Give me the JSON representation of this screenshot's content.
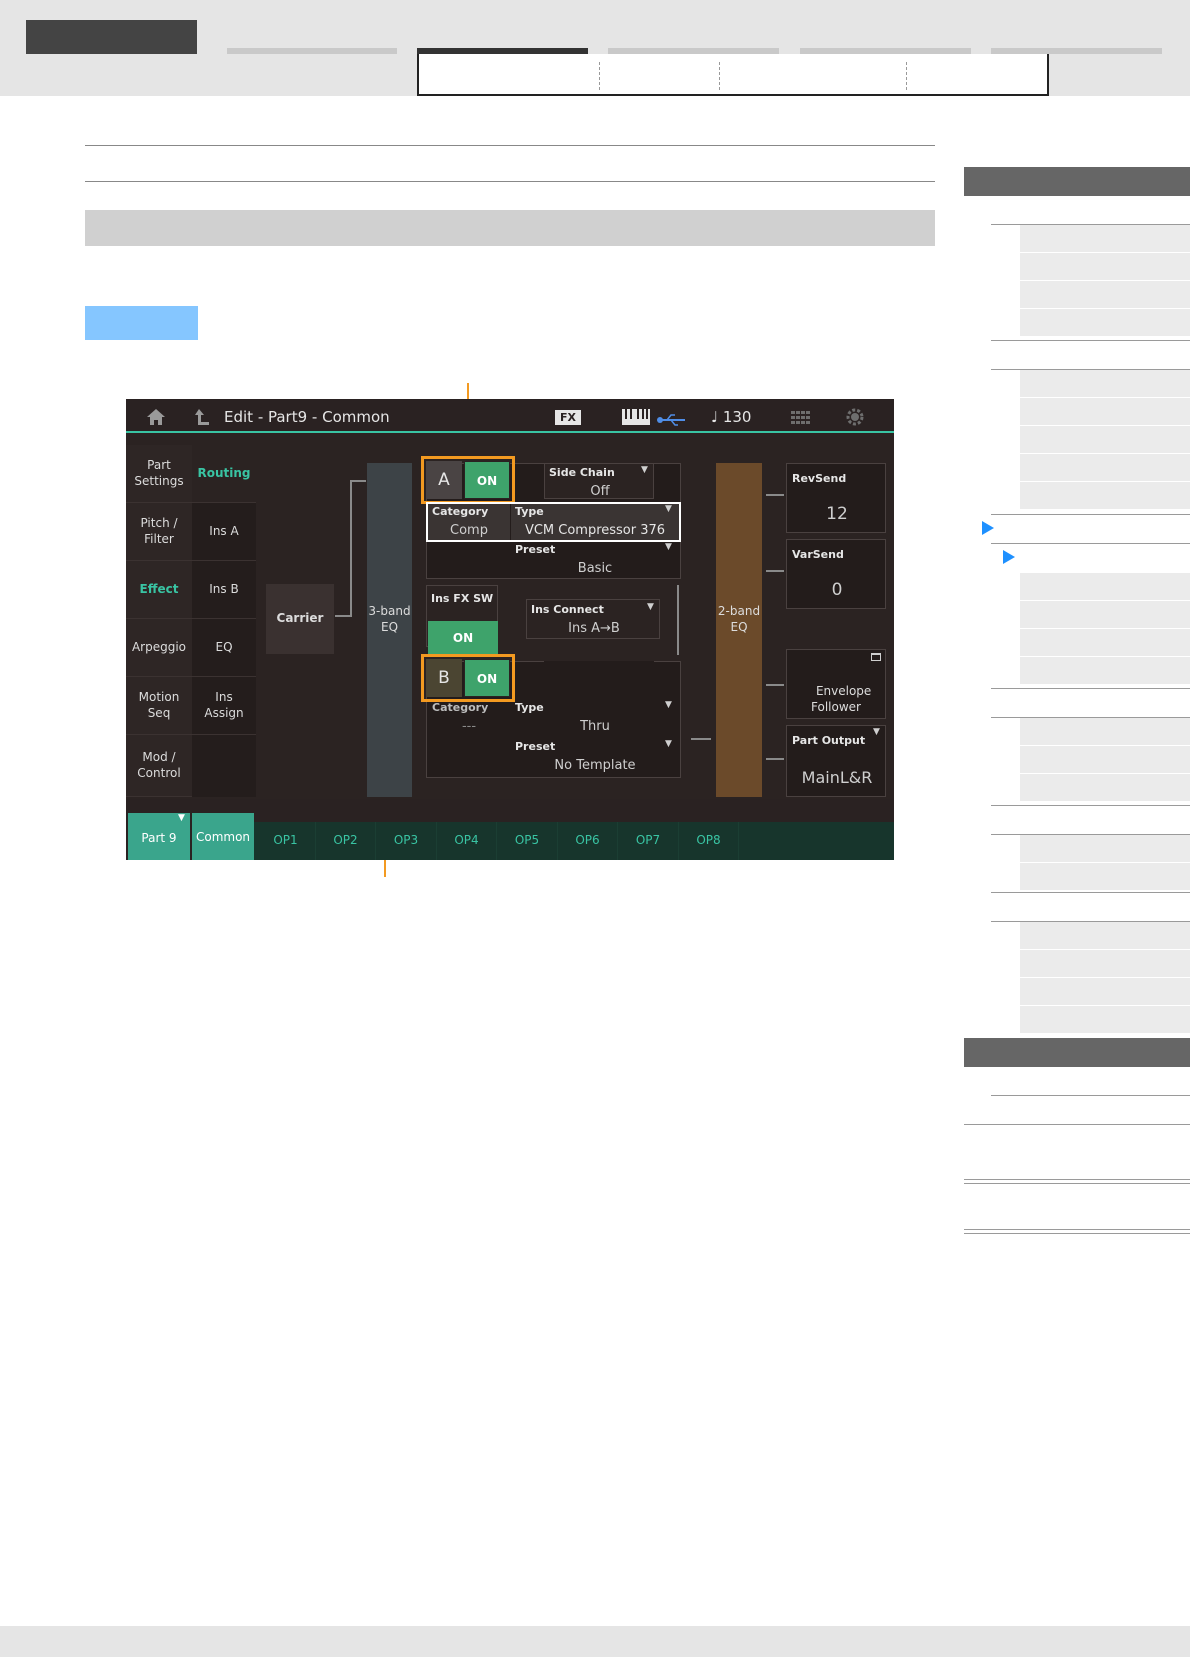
{
  "screen": {
    "title": "Edit - Part9 - Common",
    "fx_label": "FX",
    "tempo": "♩ 130",
    "left_tabs": [
      {
        "label": "Part\nSettings",
        "active": false
      },
      {
        "label": "Pitch /\nFilter",
        "active": false
      },
      {
        "label": "Effect",
        "active": true
      },
      {
        "label": "Arpeggio",
        "active": false
      },
      {
        "label": "Motion\nSeq",
        "active": false
      },
      {
        "label": "Mod /\nControl",
        "active": false
      }
    ],
    "sub_tabs": [
      {
        "label": "Routing",
        "active": true
      },
      {
        "label": "Ins A",
        "active": false
      },
      {
        "label": "Ins B",
        "active": false
      },
      {
        "label": "EQ",
        "active": false
      },
      {
        "label": "Ins\nAssign",
        "active": false
      }
    ],
    "carrier_label": "Carrier",
    "eq3_label": "3-band\nEQ",
    "eq2_label": "2-band\nEQ",
    "ins_a": {
      "letter": "A",
      "switch": "ON",
      "side_chain_label": "Side Chain",
      "side_chain_value": "Off",
      "category_label": "Category",
      "category_value": "Comp",
      "type_label": "Type",
      "type_value": "VCM Compressor 376",
      "preset_label": "Preset",
      "preset_value": "Basic"
    },
    "ins_fx_sw_label": "Ins FX SW",
    "ins_fx_sw_value": "ON",
    "ins_connect_label": "Ins Connect",
    "ins_connect_value": "Ins A→B",
    "ins_b": {
      "letter": "B",
      "switch": "ON",
      "category_label": "Category",
      "category_value": "---",
      "type_label": "Type",
      "type_value": "Thru",
      "preset_label": "Preset",
      "preset_value": "No Template"
    },
    "rev_send_label": "RevSend",
    "rev_send_value": "12",
    "var_send_label": "VarSend",
    "var_send_value": "0",
    "envelope_follower_label": "Envelope\nFollower",
    "part_output_label": "Part Output",
    "part_output_value": "MainL&R",
    "bottom_tabs": [
      "Part 9",
      "Common",
      "OP1",
      "OP2",
      "OP3",
      "OP4",
      "OP5",
      "OP6",
      "OP7",
      "OP8"
    ],
    "colors": {
      "accent": "#39c4a3",
      "on_green": "#3ea36b",
      "highlight_orange": "#f39a21",
      "eq2_brown": "#6b4a2a",
      "eq3_slate": "#3d4347"
    }
  },
  "right_nav": {
    "active_markers": 2,
    "marker_color": "#1e90ff"
  },
  "page": {
    "label_chip_color": "#85c6ff"
  }
}
